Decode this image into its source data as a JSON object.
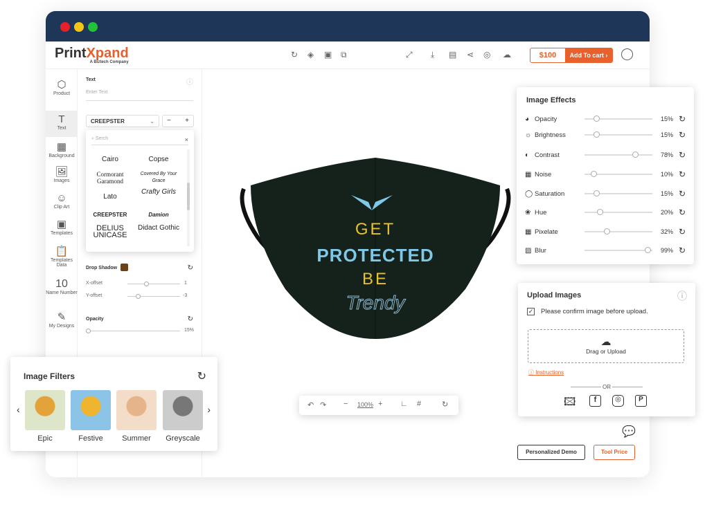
{
  "window": {
    "dots": [
      "#e8202a",
      "#f5c518",
      "#22c33a"
    ]
  },
  "logo": {
    "text_a": "Print",
    "text_b": "Xpand",
    "tagline": "A Biztech Company"
  },
  "header": {
    "price": "$100",
    "add_to_cart": "Add To cart ›"
  },
  "sidebar": {
    "items": [
      {
        "label": "Product",
        "icon": "⬡"
      },
      {
        "label": "Text",
        "icon": "T"
      },
      {
        "label": "Background",
        "icon": "▦"
      },
      {
        "label": "Images",
        "icon": "🖼"
      },
      {
        "label": "Clip Art",
        "icon": "☺"
      },
      {
        "label": "Templates",
        "icon": "▣"
      },
      {
        "label": "Templates Data",
        "icon": "📋"
      },
      {
        "label": "Name Number",
        "icon": "10"
      },
      {
        "label": "My Designs",
        "icon": "✎"
      }
    ]
  },
  "text_panel": {
    "title": "Text",
    "placeholder": "Enter Text",
    "font_selected": "CREEPSTER",
    "search_placeholder": "Serch",
    "fonts": [
      "Cairo",
      "Copse",
      "Cormorant Garamond",
      "Covered By Your Grace",
      "Lato",
      "Crafty Girls",
      "CREEPSTER",
      "Damion",
      "DELIUS UNICASE",
      "Didact Gothic"
    ],
    "drop_shadow": "Drop Shadow",
    "shadow_color": "#6b4218",
    "x_offset_label": "X-offset",
    "x_offset": "1",
    "y_offset_label": "Y-offset",
    "y_offset": "-3",
    "opacity_label": "Opacity",
    "opacity": "15%"
  },
  "mask": {
    "line1": "GET",
    "line2": "PROTECTED",
    "line3": "BE",
    "line4": "Trendy"
  },
  "canvas_toolbar": {
    "zoom": "100%"
  },
  "image_effects": {
    "title": "Image Effects",
    "items": [
      {
        "label": "Opacity",
        "value": "15%",
        "level": 15,
        "icon": "◕"
      },
      {
        "label": "Brightness",
        "value": "15%",
        "level": 15,
        "icon": "☼"
      },
      {
        "label": "Contrast",
        "value": "78%",
        "level": 78,
        "icon": "◐"
      },
      {
        "label": "Noise",
        "value": "10%",
        "level": 10,
        "icon": "▦"
      },
      {
        "label": "Saturation",
        "value": "15%",
        "level": 15,
        "icon": "◯"
      },
      {
        "label": "Hue",
        "value": "20%",
        "level": 20,
        "icon": "❀"
      },
      {
        "label": "Pixelate",
        "value": "32%",
        "level": 32,
        "icon": "▦"
      },
      {
        "label": "Blur",
        "value": "99%",
        "level": 99,
        "icon": "▨"
      }
    ]
  },
  "upload": {
    "title": "Upload Images",
    "confirm": "Please confirm image before upload.",
    "drag": "Drag or Upload",
    "instructions": "Instructions",
    "or": "OR"
  },
  "image_filters": {
    "title": "Image Filters",
    "items": [
      "Epic",
      "Festive",
      "Summer",
      "Greyscale"
    ]
  },
  "buttons": {
    "demo": "Personalized Demo",
    "price": "Tool Price"
  }
}
